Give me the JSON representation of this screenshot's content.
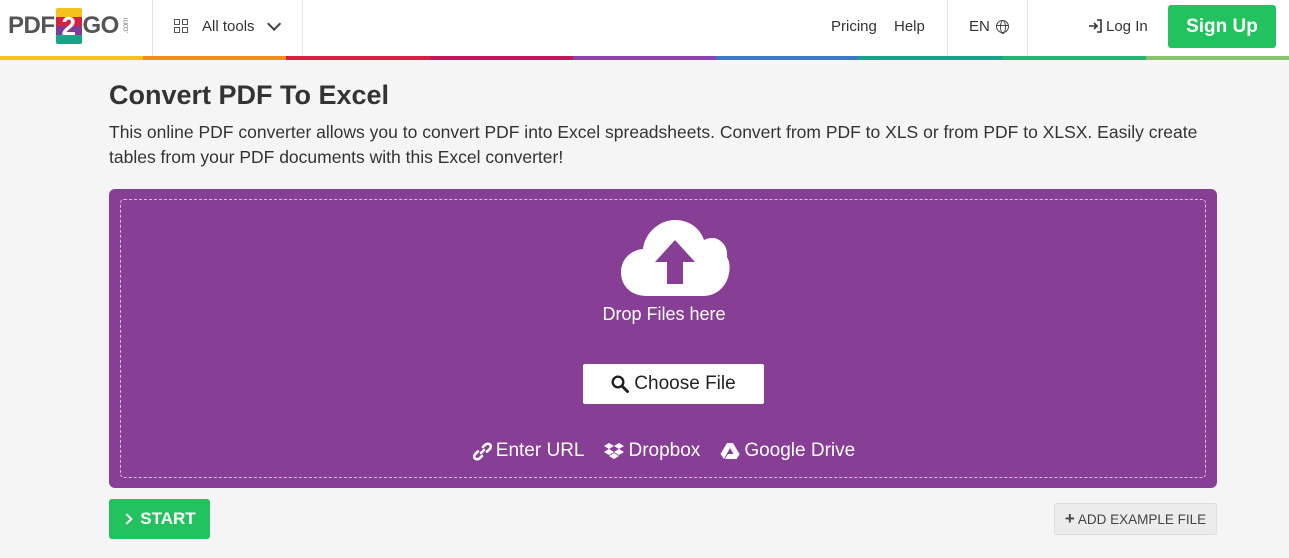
{
  "header": {
    "logo_left": "PDF",
    "logo_mid": "2",
    "logo_right": "GO",
    "logo_suffix": ".com",
    "all_tools": "All tools",
    "pricing": "Pricing",
    "help": "Help",
    "language": "EN",
    "login": "Log In",
    "signup": "Sign Up"
  },
  "colors": {
    "accent_bar": [
      "#f3c31b",
      "#f08c17",
      "#d9203e",
      "#c2185b",
      "#8e44ad",
      "#3f7ac1",
      "#17a589",
      "#22b573",
      "#8dc26f"
    ],
    "dropzone": "#873e95",
    "primary_green": "#22c35e"
  },
  "main": {
    "title": "Convert PDF To Excel",
    "description": "This online PDF converter allows you to convert PDF into Excel spreadsheets. Convert from PDF to XLS or from PDF to XLSX. Easily create tables from your PDF documents with this Excel converter!"
  },
  "dropzone": {
    "drop_text": "Drop Files here",
    "choose_file": "Choose File",
    "sources": [
      {
        "icon": "link-icon",
        "label": "Enter URL"
      },
      {
        "icon": "dropbox-icon",
        "label": "Dropbox"
      },
      {
        "icon": "google-drive-icon",
        "label": "Google Drive"
      }
    ]
  },
  "actions": {
    "start": "START",
    "add_example": "ADD EXAMPLE FILE"
  }
}
